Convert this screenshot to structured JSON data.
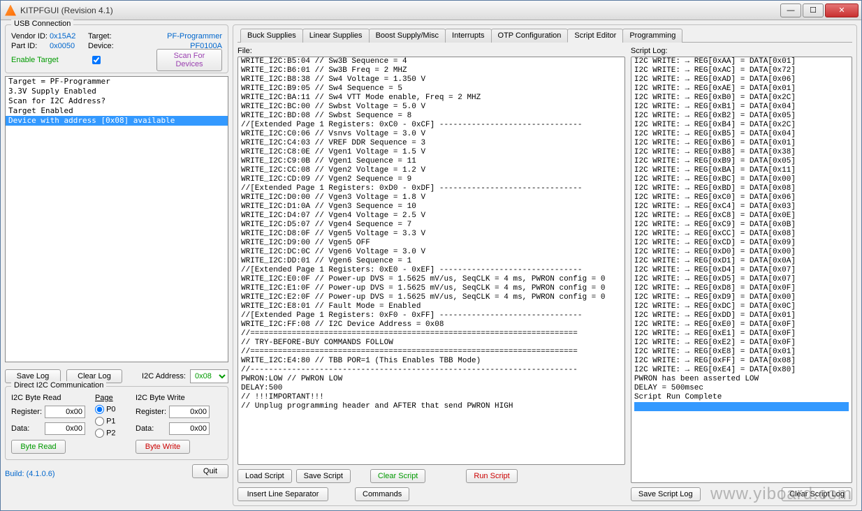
{
  "window": {
    "title": "KITPFGUI (Revision 4.1)"
  },
  "usb": {
    "group": "USB Connection",
    "vendor_id_lbl": "Vendor ID:",
    "vendor_id": "0x15A2",
    "target_lbl": "Target:",
    "target": "PF-Programmer",
    "part_id_lbl": "Part ID:",
    "part_id": "0x0050",
    "device_lbl": "Device:",
    "device": "PF0100A",
    "enable_lbl": "Enable Target",
    "scan_btn": "Scan For Devices"
  },
  "target_log": [
    {
      "t": "Target = PF-Programmer",
      "sel": false
    },
    {
      "t": "3.3V Supply Enabled",
      "sel": false
    },
    {
      "t": "Scan for I2C Address?",
      "sel": false
    },
    {
      "t": "Target Enabled",
      "sel": false
    },
    {
      "t": "Device with address [0x08] available",
      "sel": true
    }
  ],
  "save_log_btn": "Save Log",
  "clear_log_btn": "Clear Log",
  "i2c_addr_lbl": "I2C Address:",
  "i2c_addr": "0x08",
  "direct": {
    "group": "Direct I2C Communication",
    "read_lbl": "I2C Byte Read",
    "write_lbl": "I2C Byte Write",
    "page_lbl": "Page",
    "register_lbl": "Register:",
    "data_lbl": "Data:",
    "reg_r": "0x00",
    "data_r": "0x00",
    "reg_w": "0x00",
    "data_w": "0x00",
    "p0": "P0",
    "p1": "P1",
    "p2": "P2",
    "byte_read": "Byte Read",
    "byte_write": "Byte Write"
  },
  "build": "Build: (4.1.0.6)",
  "quit": "Quit",
  "tabs": [
    "Buck Supplies",
    "Linear Supplies",
    "Boost Supply/Misc",
    "Interrupts",
    "OTP Configuration",
    "Script Editor",
    "Programming"
  ],
  "active_tab": 5,
  "file_lbl": "File:",
  "script_log_lbl": "Script Log:",
  "script_lines": [
    "WRITE_I2C:B5:04 // Sw3B Sequence = 4",
    "WRITE_I2C:B6:01 // Sw3B Freq = 2 MHZ",
    "WRITE_I2C:B8:38 // Sw4 Voltage = 1.350 V",
    "WRITE_I2C:B9:05 // Sw4 Sequence = 5",
    "WRITE_I2C:BA:11 // Sw4 VTT Mode enable, Freq = 2 MHZ",
    "WRITE_I2C:BC:00 // Swbst Voltage = 5.0 V",
    "WRITE_I2C:BD:08 // Swbst Sequence = 8",
    "//[Extended Page 1 Registers: 0xC0 - 0xCF] -------------------------------",
    "WRITE_I2C:C0:06 // Vsnvs Voltage = 3.0 V",
    "WRITE_I2C:C4:03 // VREF DDR Sequence = 3",
    "WRITE_I2C:C8:0E // Vgen1 Voltage = 1.5 V",
    "WRITE_I2C:C9:0B // Vgen1 Sequence = 11",
    "WRITE_I2C:CC:08 // Vgen2 Voltage = 1.2 V",
    "WRITE_I2C:CD:09 // Vgen2 Sequence = 9",
    "//[Extended Page 1 Registers: 0xD0 - 0xDF] -------------------------------",
    "WRITE_I2C:D0:00 // Vgen3 Voltage = 1.8 V",
    "WRITE_I2C:D1:0A // Vgen3 Sequence = 10",
    "WRITE_I2C:D4:07 // Vgen4 Voltage = 2.5 V",
    "WRITE_I2C:D5:07 // Vgen4 Sequence = 7",
    "WRITE_I2C:D8:0F // Vgen5 Voltage = 3.3 V",
    "WRITE_I2C:D9:00 // Vgen5 OFF",
    "WRITE_I2C:DC:0C // Vgen6 Voltage = 3.0 V",
    "WRITE_I2C:DD:01 // Vgen6 Sequence = 1",
    "//[Extended Page 1 Registers: 0xE0 - 0xEF] -------------------------------",
    "WRITE_I2C:E0:0F // Power-up DVS = 1.5625 mV/us, SeqCLK = 4 ms, PWRON config = 0",
    "WRITE_I2C:E1:0F // Power-up DVS = 1.5625 mV/us, SeqCLK = 4 ms, PWRON config = 0",
    "WRITE_I2C:E2:0F // Power-up DVS = 1.5625 mV/us, SeqCLK = 4 ms, PWRON config = 0",
    "WRITE_I2C:E8:01 // Fault Mode = Enabled",
    "//[Extended Page 1 Registers: 0xF0 - 0xFF] -------------------------------",
    "WRITE_I2C:FF:08 // I2C Device Address = 0x08",
    "//=======================================================================",
    "// TRY-BEFORE-BUY COMMANDS FOLLOW",
    "//=======================================================================",
    "WRITE_I2C:E4:80 // TBB POR=1 (This Enables TBB Mode)",
    "//-----------------------------------------------------------------------",
    "PWRON:LOW // PWRON LOW",
    "DELAY:500",
    "// !!!IMPORTANT!!!",
    "// Unplug programming header and AFTER that send PWRON HIGH"
  ],
  "script_log": [
    "I2C WRITE: → REG[0xAA] = DATA[0x01]",
    "I2C WRITE: → REG[0xAC] = DATA[0x72]",
    "I2C WRITE: → REG[0xAD] = DATA[0x06]",
    "I2C WRITE: → REG[0xAE] = DATA[0x01]",
    "I2C WRITE: → REG[0xB0] = DATA[0x2C]",
    "I2C WRITE: → REG[0xB1] = DATA[0x04]",
    "I2C WRITE: → REG[0xB2] = DATA[0x05]",
    "I2C WRITE: → REG[0xB4] = DATA[0x2C]",
    "I2C WRITE: → REG[0xB5] = DATA[0x04]",
    "I2C WRITE: → REG[0xB6] = DATA[0x01]",
    "I2C WRITE: → REG[0xB8] = DATA[0x38]",
    "I2C WRITE: → REG[0xB9] = DATA[0x05]",
    "I2C WRITE: → REG[0xBA] = DATA[0x11]",
    "I2C WRITE: → REG[0xBC] = DATA[0x00]",
    "I2C WRITE: → REG[0xBD] = DATA[0x08]",
    "I2C WRITE: → REG[0xC0] = DATA[0x06]",
    "I2C WRITE: → REG[0xC4] = DATA[0x03]",
    "I2C WRITE: → REG[0xC8] = DATA[0x0E]",
    "I2C WRITE: → REG[0xC9] = DATA[0x0B]",
    "I2C WRITE: → REG[0xCC] = DATA[0x08]",
    "I2C WRITE: → REG[0xCD] = DATA[0x09]",
    "I2C WRITE: → REG[0xD0] = DATA[0x00]",
    "I2C WRITE: → REG[0xD1] = DATA[0x0A]",
    "I2C WRITE: → REG[0xD4] = DATA[0x07]",
    "I2C WRITE: → REG[0xD5] = DATA[0x07]",
    "I2C WRITE: → REG[0xD8] = DATA[0x0F]",
    "I2C WRITE: → REG[0xD9] = DATA[0x00]",
    "I2C WRITE: → REG[0xDC] = DATA[0x0C]",
    "I2C WRITE: → REG[0xDD] = DATA[0x01]",
    "I2C WRITE: → REG[0xE0] = DATA[0x0F]",
    "I2C WRITE: → REG[0xE1] = DATA[0x0F]",
    "I2C WRITE: → REG[0xE2] = DATA[0x0F]",
    "I2C WRITE: → REG[0xE8] = DATA[0x01]",
    "I2C WRITE: → REG[0xFF] = DATA[0x08]",
    "I2C WRITE: → REG[0xE4] = DATA[0x80]",
    "PWRON has been asserted LOW",
    "DELAY = 500msec",
    "Script Run Complete"
  ],
  "buttons": {
    "load": "Load Script",
    "save": "Save Script",
    "clear": "Clear Script",
    "run": "Run Script",
    "insert": "Insert Line Separator",
    "commands": "Commands",
    "save_log": "Save Script Log",
    "clear_log": "Clear Script Log"
  },
  "watermark": "www.yiboard.com"
}
